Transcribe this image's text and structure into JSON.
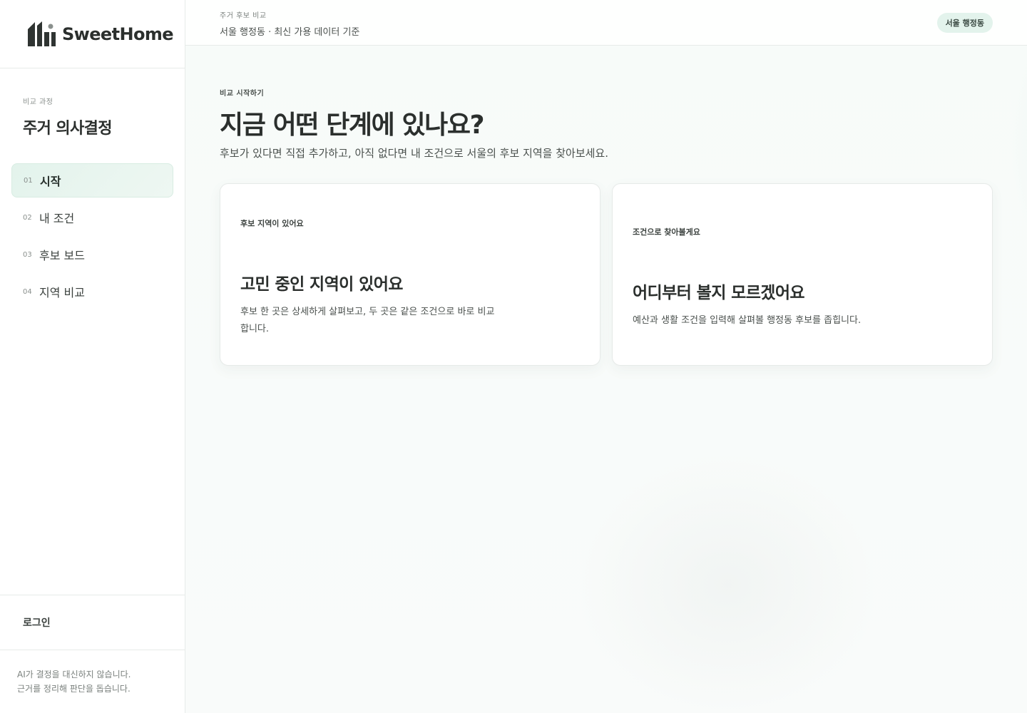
{
  "brand": {
    "name": "SweetHome",
    "logo_icon": "house-bars-icon",
    "accent": "#e3f3ec"
  },
  "sidebar": {
    "process_label": "비교 과정",
    "process_title": "주거 의사결정",
    "items": [
      {
        "num": "01",
        "label": "시작",
        "active": true
      },
      {
        "num": "02",
        "label": "내 조건",
        "active": false
      },
      {
        "num": "03",
        "label": "후보 보드",
        "active": false
      },
      {
        "num": "04",
        "label": "지역 비교",
        "active": false
      }
    ],
    "login_label": "로그인",
    "footnote_line1": "AI가 결정을 대신하지 않습니다.",
    "footnote_line2": "근거를 정리해 판단을 돕습니다."
  },
  "topbar": {
    "eyebrow": "주거 후보 비교",
    "subtitle": "서울 행정동 · 최신 가용 데이터 기준",
    "region_badge": "서울 행정동"
  },
  "hero": {
    "eyebrow": "비교 시작하기",
    "title": "지금 어떤 단계에 있나요?",
    "description": "후보가 있다면 직접 추가하고, 아직 없다면 내 조건으로 서울의 후보 지역을 찾아보세요."
  },
  "cards": [
    {
      "eyebrow": "후보 지역이 있어요",
      "title": "고민 중인 지역이 있어요",
      "desc_line1": "후보 한 곳은 상세하게 살펴보고, 두 곳은 같은 조건으로 바로 비교",
      "desc_line2": "합니다."
    },
    {
      "eyebrow": "조건으로 찾아볼게요",
      "title": "어디부터 볼지 모르겠어요",
      "desc_line1": "예산과 생활 조건을 입력해 살펴볼 행정동 후보를 좁힙니다."
    }
  ]
}
